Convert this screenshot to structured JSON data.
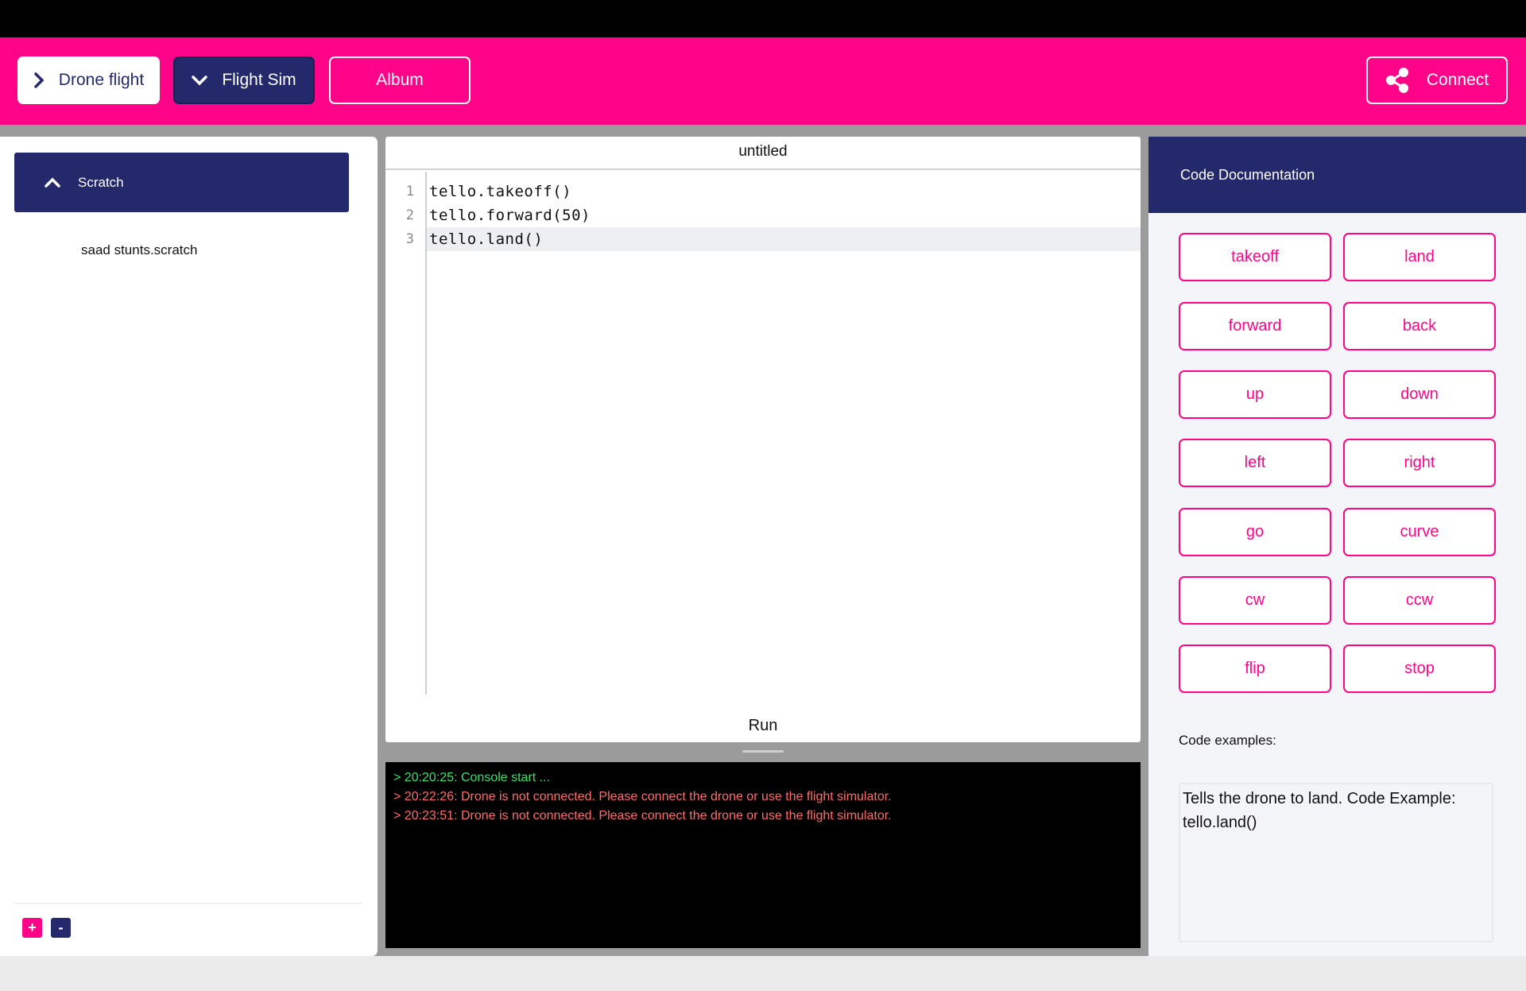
{
  "header": {
    "drone_flight_label": "Drone flight",
    "flight_sim_label": "Flight Sim",
    "album_label": "Album",
    "connect_label": "Connect"
  },
  "sidebar": {
    "section_label": "Scratch",
    "files": [
      "saad stunts.scratch"
    ],
    "add_label": "+",
    "remove_label": "-"
  },
  "editor": {
    "title": "untitled",
    "lines": [
      {
        "num": "1",
        "code": "tello.takeoff()"
      },
      {
        "num": "2",
        "code": "tello.forward(50)"
      },
      {
        "num": "3",
        "code": "tello.land()"
      }
    ],
    "run_label": "Run"
  },
  "console": {
    "lines": [
      {
        "text": "> 20:20:25: Console start ...",
        "status": "ok"
      },
      {
        "text": "> 20:22:26: Drone is not connected. Please connect the drone or use the flight simulator.",
        "status": "error"
      },
      {
        "text": "> 20:23:51: Drone is not connected. Please connect the drone or use the flight simulator.",
        "status": "error"
      }
    ]
  },
  "docs": {
    "title": "Code Documentation",
    "commands": [
      "takeoff",
      "land",
      "forward",
      "back",
      "up",
      "down",
      "left",
      "right",
      "go",
      "curve",
      "cw",
      "ccw",
      "flip",
      "stop"
    ],
    "examples_label": "Code examples:",
    "example_text": "Tells the drone to land. Code Example: tello.land()"
  },
  "colors": {
    "brand_pink": "#ff0489",
    "navy": "#24296b",
    "console_ok": "#37e36d",
    "console_error": "#ff6b6b"
  }
}
